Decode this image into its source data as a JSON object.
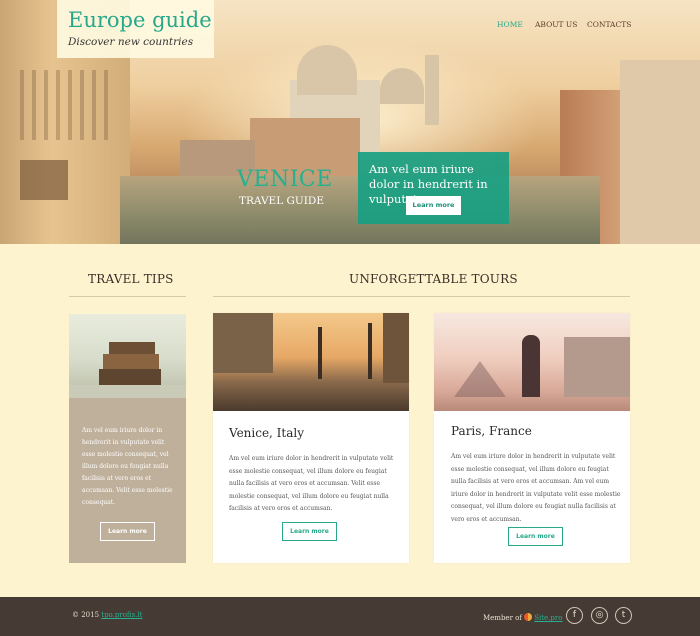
{
  "brand": {
    "title": "Europe guide",
    "subtitle": "Discover new countries"
  },
  "nav": {
    "items": [
      {
        "label": "HOME"
      },
      {
        "label": "ABOUT US"
      },
      {
        "label": "CONTACTS"
      }
    ],
    "active": "HOME"
  },
  "hero": {
    "city": "VENICE",
    "tagline": "TRAVEL GUIDE",
    "promo_text": "Am vel eum iriure dolor in hendrerit in vulputate.",
    "promo_button": "Learn more"
  },
  "sections": {
    "tips_title": "TRAVEL TIPS",
    "tours_title": "UNFORGETTABLE TOURS"
  },
  "tips": {
    "text": "Am vel eum iriure dolor in hendrerit in vulputate velit esse molestie consequat, vel illum dolore eu feugiat nulla facilisis at vero eros et accumsan. Velit esse molestie consequat.",
    "button": "Learn more"
  },
  "tours": [
    {
      "title": "Venice, Italy",
      "text": "Am vel eum iriure dolor in hendrerit in vulputate velit esse molestie consequat, vel illum dolore eu feugiat nulla facilisis at vero eros et accumsan. Velit esse molestie consequat, vel illum dolore eu feugiat nulla facilisis at vero eros et accumsan.",
      "button": "Learn more"
    },
    {
      "title": "Paris, France",
      "text": "Am vel eum iriure dolor in hendrerit in vulputate velit esse molestie consequat, vel illum dolore eu feugiat nulla facilisis at vero eros et accumsan. Am vel eum iriure dolor in hendrerit in vulputate velit esse molestie consequat, vel illum dolore eu feugiat nulla facilisis at vero eros et accumsan.",
      "button": "Learn more"
    }
  ],
  "footer": {
    "copyright_prefix": "© 2015 ",
    "copyright_link": "tpo.profis.lt",
    "member_prefix": "Member of ",
    "member_link": "Site.pro",
    "social": [
      {
        "name": "facebook",
        "glyph": "f"
      },
      {
        "name": "instagram",
        "glyph": "◎"
      },
      {
        "name": "twitter",
        "glyph": "t"
      }
    ]
  },
  "colors": {
    "accent": "#27a88a",
    "background": "#fdf4cf",
    "footer": "#463a34",
    "tips_card": "#bfb09b"
  }
}
